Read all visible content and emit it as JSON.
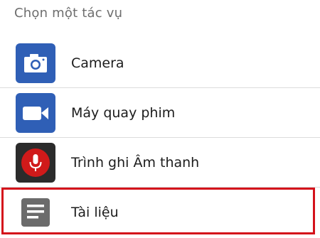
{
  "dialog": {
    "title": "Chọn một tác vụ",
    "items": [
      {
        "label": "Camera",
        "icon": "camera-icon",
        "color": "#2f5fb6"
      },
      {
        "label": "Máy quay phim",
        "icon": "video-camera-icon",
        "color": "#2f5fb6"
      },
      {
        "label": "Trình ghi Âm thanh",
        "icon": "microphone-icon",
        "color": "#2b2b2b"
      },
      {
        "label": "Tài liệu",
        "icon": "document-icon",
        "color": "#6b6b6b"
      }
    ],
    "highlight_color": "#d4121b"
  }
}
